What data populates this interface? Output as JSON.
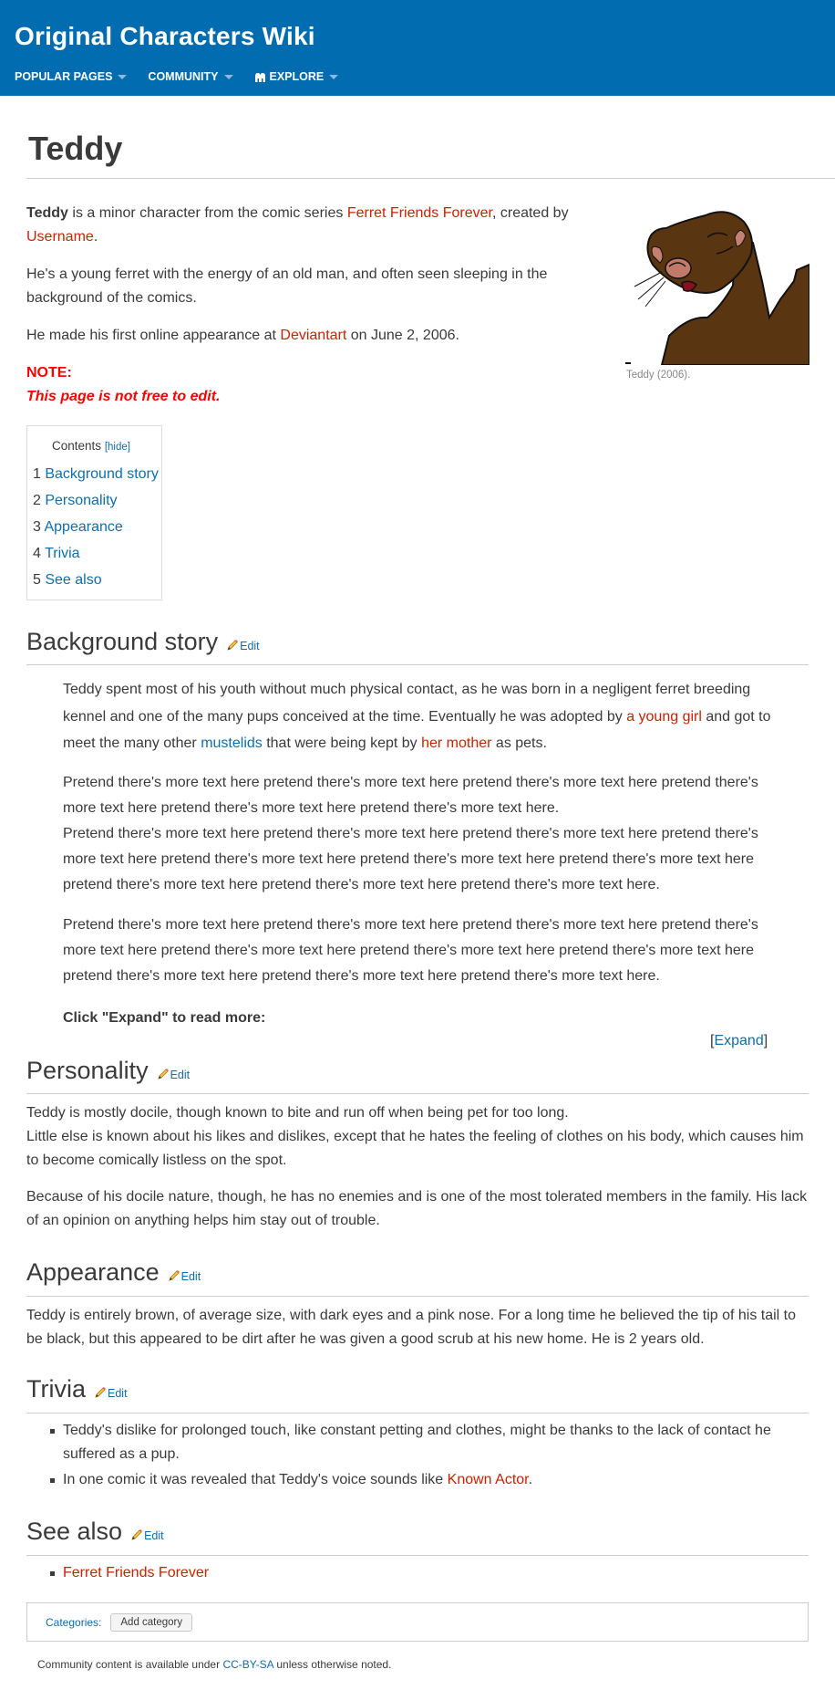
{
  "header": {
    "wiki_name": "Original Characters Wiki",
    "nav": [
      {
        "label": "POPULAR PAGES",
        "icon": "chevron-down-icon"
      },
      {
        "label": "COMMUNITY",
        "icon": "chevron-down-icon"
      },
      {
        "label": "EXPLORE",
        "icon": "explore-icon"
      }
    ],
    "background_color": "#026cb0"
  },
  "page": {
    "title": "Teddy"
  },
  "intro": {
    "p1": {
      "bold": "Teddy",
      "t1": " is a minor character from the comic series ",
      "link1": "Ferret Friends Forever",
      "t2": ", created by ",
      "link2": "Username",
      "t3": "."
    },
    "p2": "He's a young ferret with the energy of an old man, and often seen sleeping in the background of the comics.",
    "p3": {
      "t1": "He made his first online appearance at ",
      "link": "Deviantart",
      "t2": " on June 2, 2006."
    },
    "note_label": "NOTE:",
    "note_text": "This page is not free to edit."
  },
  "thumbnail": {
    "alt": "Teddy ferret drawing",
    "caption": "Teddy (2006)."
  },
  "toc": {
    "title": "Contents",
    "hide_label": "[hide]",
    "items": [
      {
        "num": "1",
        "label": "Background story"
      },
      {
        "num": "2",
        "label": "Personality"
      },
      {
        "num": "3",
        "label": "Appearance"
      },
      {
        "num": "4",
        "label": "Trivia"
      },
      {
        "num": "5",
        "label": "See also"
      }
    ]
  },
  "edit_label": "Edit",
  "sections": {
    "background": {
      "heading": "Background story",
      "p1": {
        "t1": "Teddy spent most of his youth without much physical contact, as he was born in a negligent ferret breeding kennel and one of the many pups conceived at the time. Eventually he was adopted by ",
        "link1": "a young girl",
        "t2": " and got to meet the many other ",
        "link2": "mustelids",
        "t3": " that were being kept by ",
        "link3": "her mother",
        "t4": " as pets."
      },
      "p2a": "Pretend there's more text here pretend there's more text here pretend there's more text here pretend there's more text here pretend there's more text here pretend there's more text here.",
      "p2b": "Pretend there's more text here pretend there's more text here pretend there's more text here pretend there's more text here pretend there's more text here pretend there's more text here pretend there's more text here pretend there's more text here pretend there's more text here pretend there's more text here.",
      "p3": "Pretend there's more text here pretend there's more text here pretend there's more text here pretend there's more text here pretend there's more text here pretend there's more text here pretend there's more text here pretend there's more text here pretend there's more text here pretend there's more text here.",
      "click_expand": "Click \"Expand\" to read more:",
      "expand_label": "Expand"
    },
    "personality": {
      "heading": "Personality",
      "p1a": "Teddy is mostly docile, though known to bite and run off when being pet for too long.",
      "p1b": "Little else is known about his likes and dislikes, except that he hates the feeling of clothes on his body, which causes him to become comically listless on the spot.",
      "p2": "Because of his docile nature, though, he has no enemies and is one of the most tolerated members in the family. His lack of an opinion on anything helps him stay out of trouble."
    },
    "appearance": {
      "heading": "Appearance",
      "p1": "Teddy is entirely brown, of average size, with dark eyes and a pink nose. For a long time he believed the tip of his tail to be black, but this appeared to be dirt after he was given a good scrub at his new home. He is 2 years old."
    },
    "trivia": {
      "heading": "Trivia",
      "item1": "Teddy's dislike for prolonged touch, like constant petting and clothes, might be thanks to the lack of contact he suffered as a pup.",
      "item2": {
        "t1": "In one comic it was revealed that Teddy's voice sounds like ",
        "link": "Known Actor",
        "t2": "."
      }
    },
    "see_also": {
      "heading": "See also",
      "items": [
        "Ferret Friends Forever"
      ]
    }
  },
  "categories": {
    "label": "Categories:",
    "add_button": "Add category"
  },
  "footer": {
    "t1": "Community content is available under ",
    "link": "CC-BY-SA",
    "t2": " unless otherwise noted."
  },
  "colors": {
    "link_blue": "#0b6fb0",
    "redlink": "#cc2200",
    "note_red": "#ff0000",
    "text": "#3a3a3a"
  }
}
